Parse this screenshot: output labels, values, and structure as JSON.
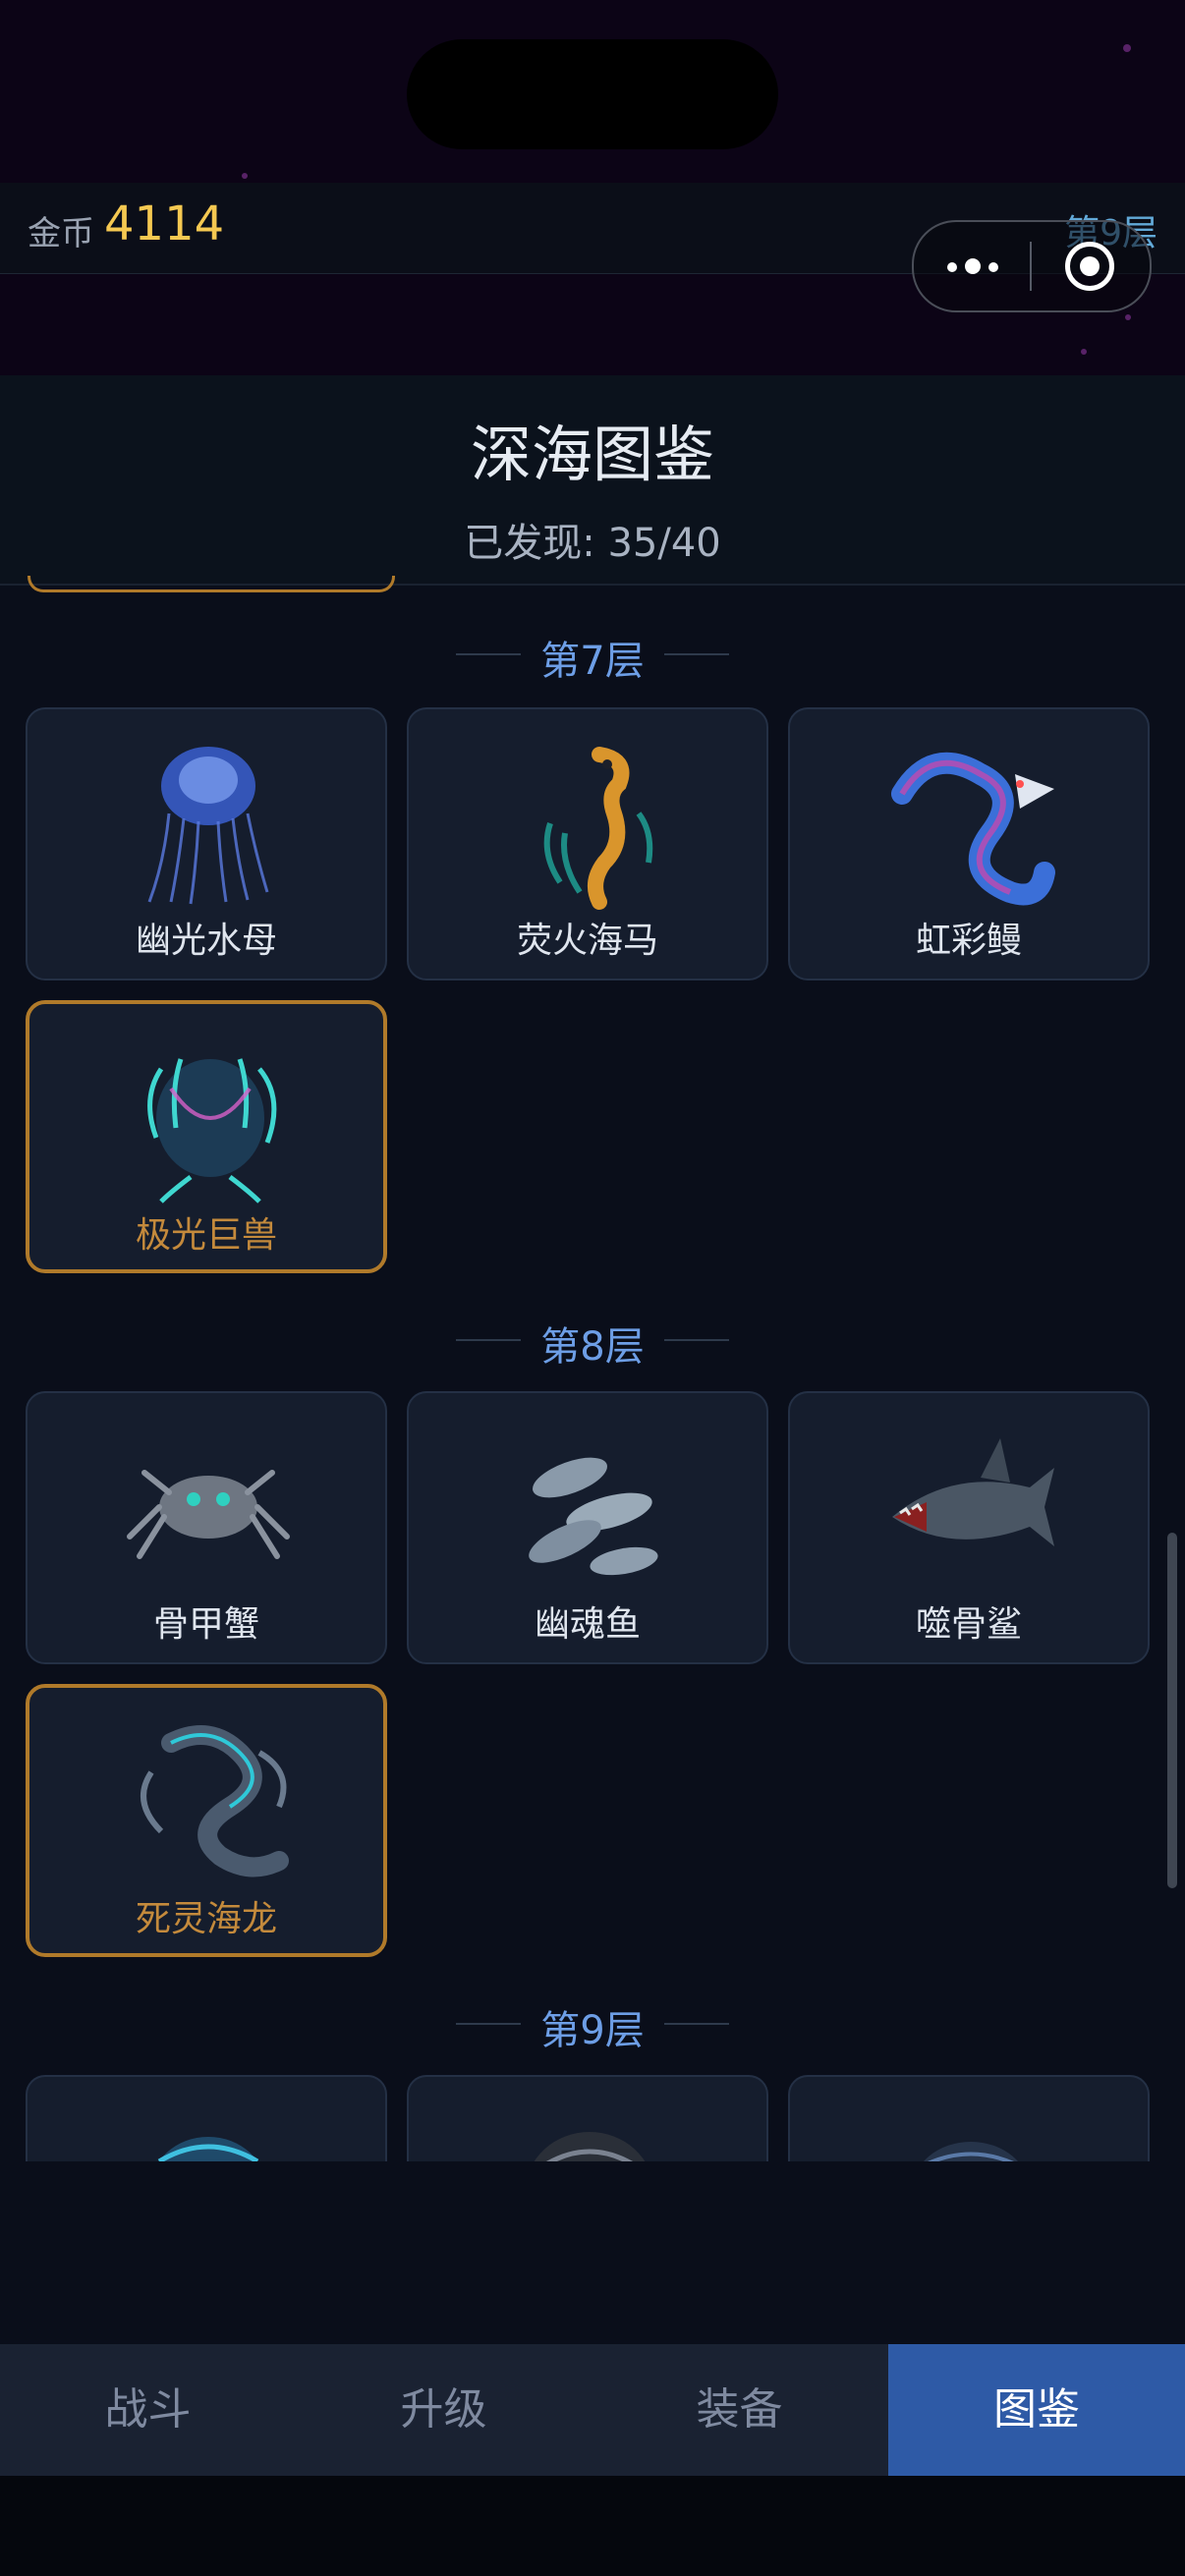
{
  "header_bar": {
    "coin_label": "金币",
    "coin_value": "4114",
    "floor": "第9层"
  },
  "page": {
    "title": "深海图鉴",
    "discovered": "已发现: 35/40"
  },
  "sections": [
    {
      "label": "第7层",
      "creatures": [
        {
          "name": "幽光水母",
          "icon": "jellyfish-icon",
          "boss": false
        },
        {
          "name": "荧火海马",
          "icon": "seahorse-icon",
          "boss": false
        },
        {
          "name": "虹彩鳗",
          "icon": "eel-icon",
          "boss": false
        },
        {
          "name": "极光巨兽",
          "icon": "aurora-beast-icon",
          "boss": true
        }
      ]
    },
    {
      "label": "第8层",
      "creatures": [
        {
          "name": "骨甲蟹",
          "icon": "crab-icon",
          "boss": false
        },
        {
          "name": "幽魂鱼",
          "icon": "ghost-fish-icon",
          "boss": false
        },
        {
          "name": "噬骨鲨",
          "icon": "shark-icon",
          "boss": false
        },
        {
          "name": "死灵海龙",
          "icon": "sea-dragon-icon",
          "boss": true
        }
      ]
    },
    {
      "label": "第9层",
      "creatures": []
    }
  ],
  "tabs": [
    {
      "label": "战斗",
      "active": false
    },
    {
      "label": "升级",
      "active": false
    },
    {
      "label": "装备",
      "active": false
    },
    {
      "label": "图鉴",
      "active": true
    }
  ],
  "colors": {
    "gold": "#f5c851",
    "boss_border": "#b07a2a",
    "active_tab": "#2e5aa6",
    "section_label": "#6d9ee6"
  }
}
